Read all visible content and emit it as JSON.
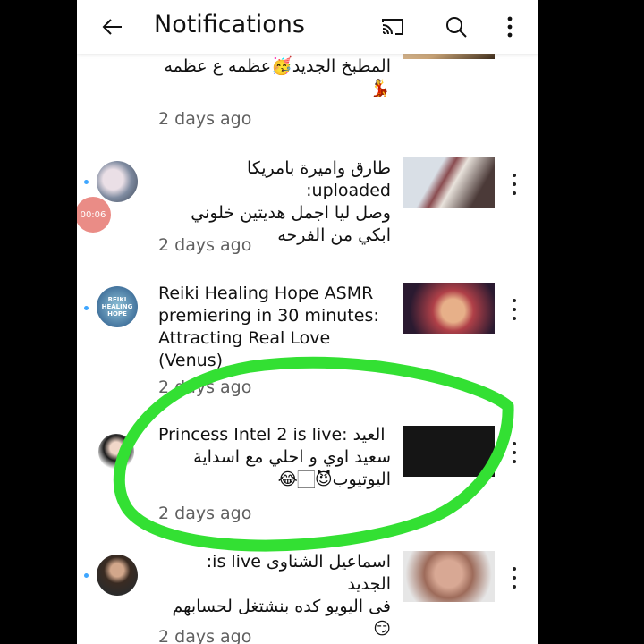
{
  "appbar": {
    "title": "Notifications",
    "back_icon": "arrow-left-icon",
    "cast_icon": "cast-icon",
    "search_icon": "search-icon",
    "more_icon": "more-vertical-icon"
  },
  "mini_player": {
    "time": "00:06"
  },
  "notifications": [
    {
      "text_line1": "المطبخ الجديد🥳عظمه ع عظمه",
      "text_line2": "💃",
      "time": "2 days ago"
    },
    {
      "text_line1": "طارق واميرة بامريكا uploaded:",
      "text_line2": "وصل ليا اجمل هديتين خلوني",
      "text_line3": "ابكي من الفرحه",
      "time": "2 days ago"
    },
    {
      "avatar_text": "REIKI HEALING HOPE",
      "text": "Reiki Healing Hope ASMR premiering in 30 minutes: Attracting Real Love (Venus)",
      "time": "2 days ago"
    },
    {
      "text_line1": "Princess Intel 2 is live: العيد",
      "text_line2": "سعيد اوي و احلي مع اسداية",
      "text_line3": "اليوتيوب😈🏻😂",
      "time": "2 days ago"
    },
    {
      "text_line1": "اسماعيل الشناوى is live: الجديد",
      "text_line2": "فى اليويو كده بنشتغل لحسابهم",
      "text_line3": "😏",
      "time": "2 days ago"
    }
  ],
  "colors": {
    "annotation_stroke": "#33e033",
    "unread_dot": "#3ea6ff",
    "mini_player": "#ea8c86"
  }
}
